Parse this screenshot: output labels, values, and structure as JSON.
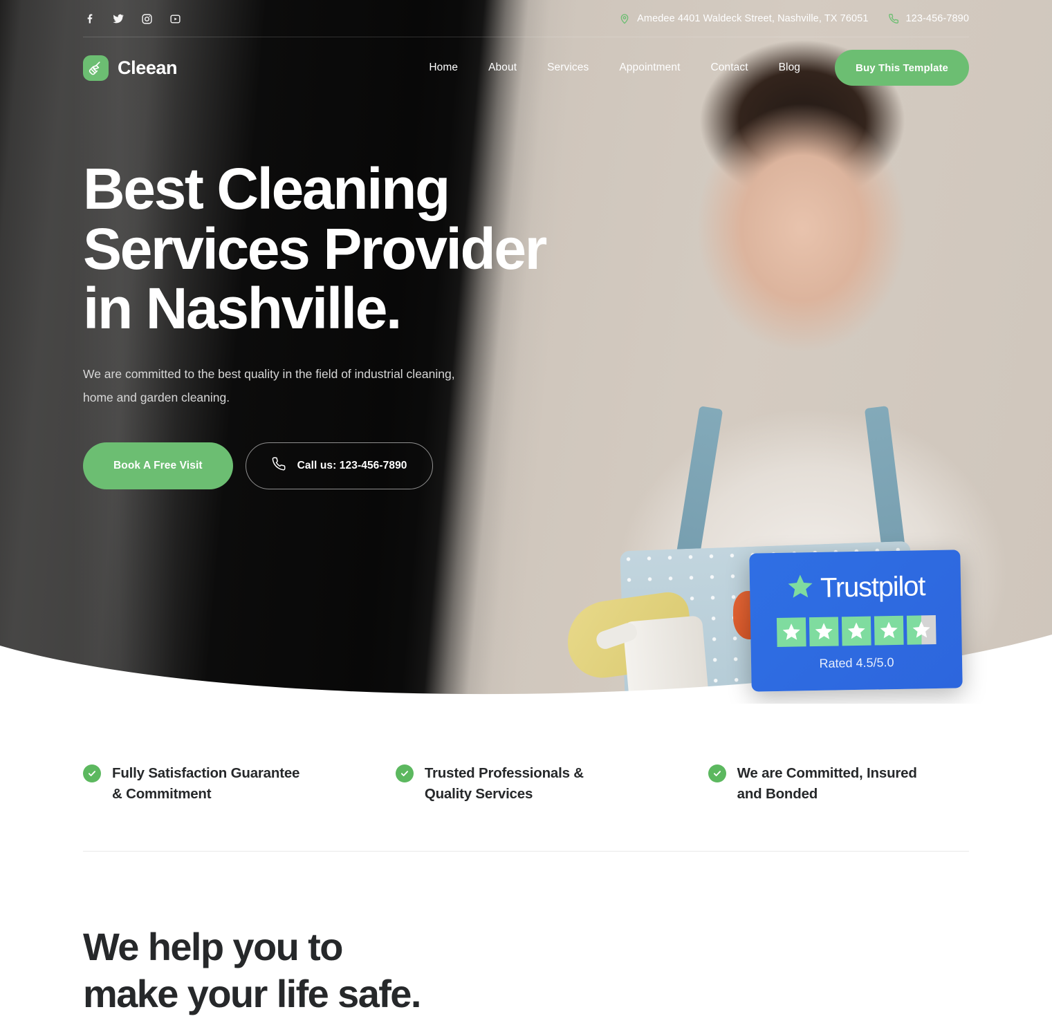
{
  "topbar": {
    "socials": [
      {
        "name": "facebook-icon",
        "label": "Facebook"
      },
      {
        "name": "twitter-icon",
        "label": "Twitter"
      },
      {
        "name": "instagram-icon",
        "label": "Instagram"
      },
      {
        "name": "youtube-icon",
        "label": "YouTube"
      }
    ],
    "address": "Amedee 4401 Waldeck Street, Nashville, TX 76051",
    "phone": "123-456-7890"
  },
  "brand": {
    "name": "Cleean",
    "icon": "broom-icon"
  },
  "nav": {
    "items": [
      {
        "label": "Home"
      },
      {
        "label": "About"
      },
      {
        "label": "Services"
      },
      {
        "label": "Appointment"
      },
      {
        "label": "Contact"
      },
      {
        "label": "Blog"
      }
    ],
    "cta_label": "Buy This Template"
  },
  "hero": {
    "title_line1": "Best Cleaning",
    "title_line2": "Services Provider",
    "title_line3": "in Nashville.",
    "subtitle": "We are committed to the best quality in the field of industrial cleaning, home and garden cleaning.",
    "primary_cta": "Book A Free Visit",
    "secondary_cta": "Call us: 123-456-7890"
  },
  "trustpilot": {
    "name": "Trustpilot",
    "rating_text": "Rated 4.5/5.0",
    "stars": 4.5,
    "star_total": 5
  },
  "features": [
    {
      "line1": "Fully Satisfaction Guarantee",
      "line2": "& Commitment"
    },
    {
      "line1": "Trusted Professionals &",
      "line2": "Quality Services"
    },
    {
      "line1": "We are Committed, Insured",
      "line2": "and Bonded"
    }
  ],
  "lower_section": {
    "heading_line1": "We help you to",
    "heading_line2": "make your life safe."
  },
  "colors": {
    "accent_green": "#6cbe72",
    "check_green": "#5cb85f",
    "trustpilot_blue": "#2f6fe4",
    "trustpilot_star_green": "#7fdc9f",
    "text_dark": "#26282a"
  }
}
